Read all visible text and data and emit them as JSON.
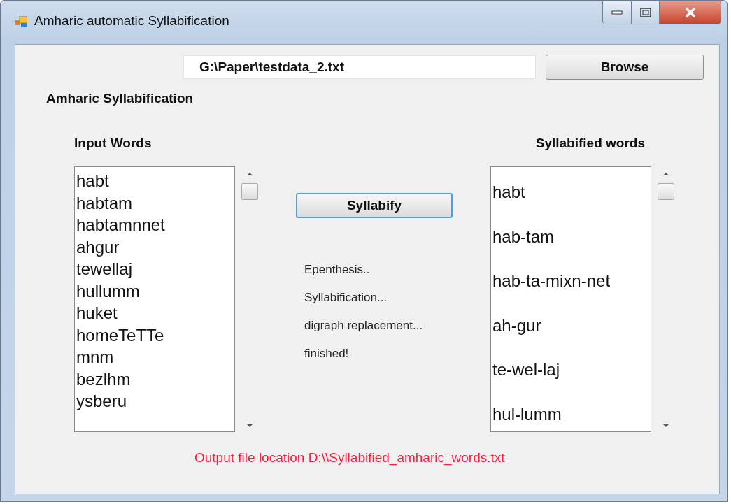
{
  "window": {
    "title": "Amharic automatic Syllabification"
  },
  "file_path": {
    "value": "G:\\Paper\\testdata_2.txt"
  },
  "browse_button": "Browse",
  "group_label": "Amharic Syllabification",
  "input_panel": {
    "label": "Input Words",
    "items": [
      "habt",
      "habtam",
      "habtamnnet",
      "ahgur",
      "tewellaj",
      "hullumm",
      "huket",
      "homeTeTTe",
      "mnm",
      "bezlhm",
      "ysberu"
    ]
  },
  "syllabify_button": "Syllabify",
  "status_lines": [
    "Epenthesis..",
    "Syllabification...",
    "digraph replacement...",
    "finished!"
  ],
  "output_panel": {
    "label": "Syllabified words",
    "items": [
      "habt",
      "hab-tam",
      "hab-ta-mixn-net",
      "ah-gur",
      "te-wel-laj",
      "hul-lumm"
    ]
  },
  "output_message": "Output file location D:\\\\Syllabified_amharic_words.txt"
}
